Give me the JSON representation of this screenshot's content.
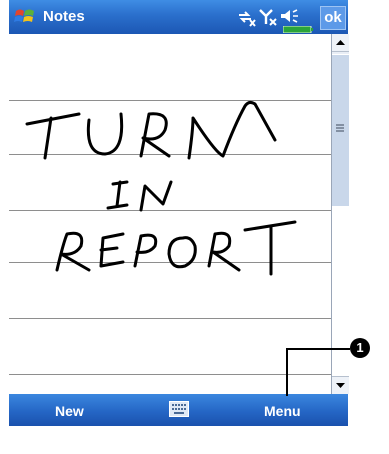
{
  "title_bar": {
    "app_title": "Notes",
    "ok_label": "ok",
    "icons": [
      "windows-start-icon",
      "connectivity-icon",
      "signal-icon",
      "volume-icon",
      "battery-icon"
    ]
  },
  "note": {
    "handwriting": [
      "TURN",
      "IN",
      "REPORT"
    ]
  },
  "softkeys": {
    "left_label": "New",
    "right_label": "Menu",
    "center_icon": "keyboard-icon"
  },
  "callout": {
    "number": "1"
  },
  "colors": {
    "titlebar": "#2a6fcc",
    "softbar": "#2566c5",
    "rule_line": "#8e8e8e"
  }
}
